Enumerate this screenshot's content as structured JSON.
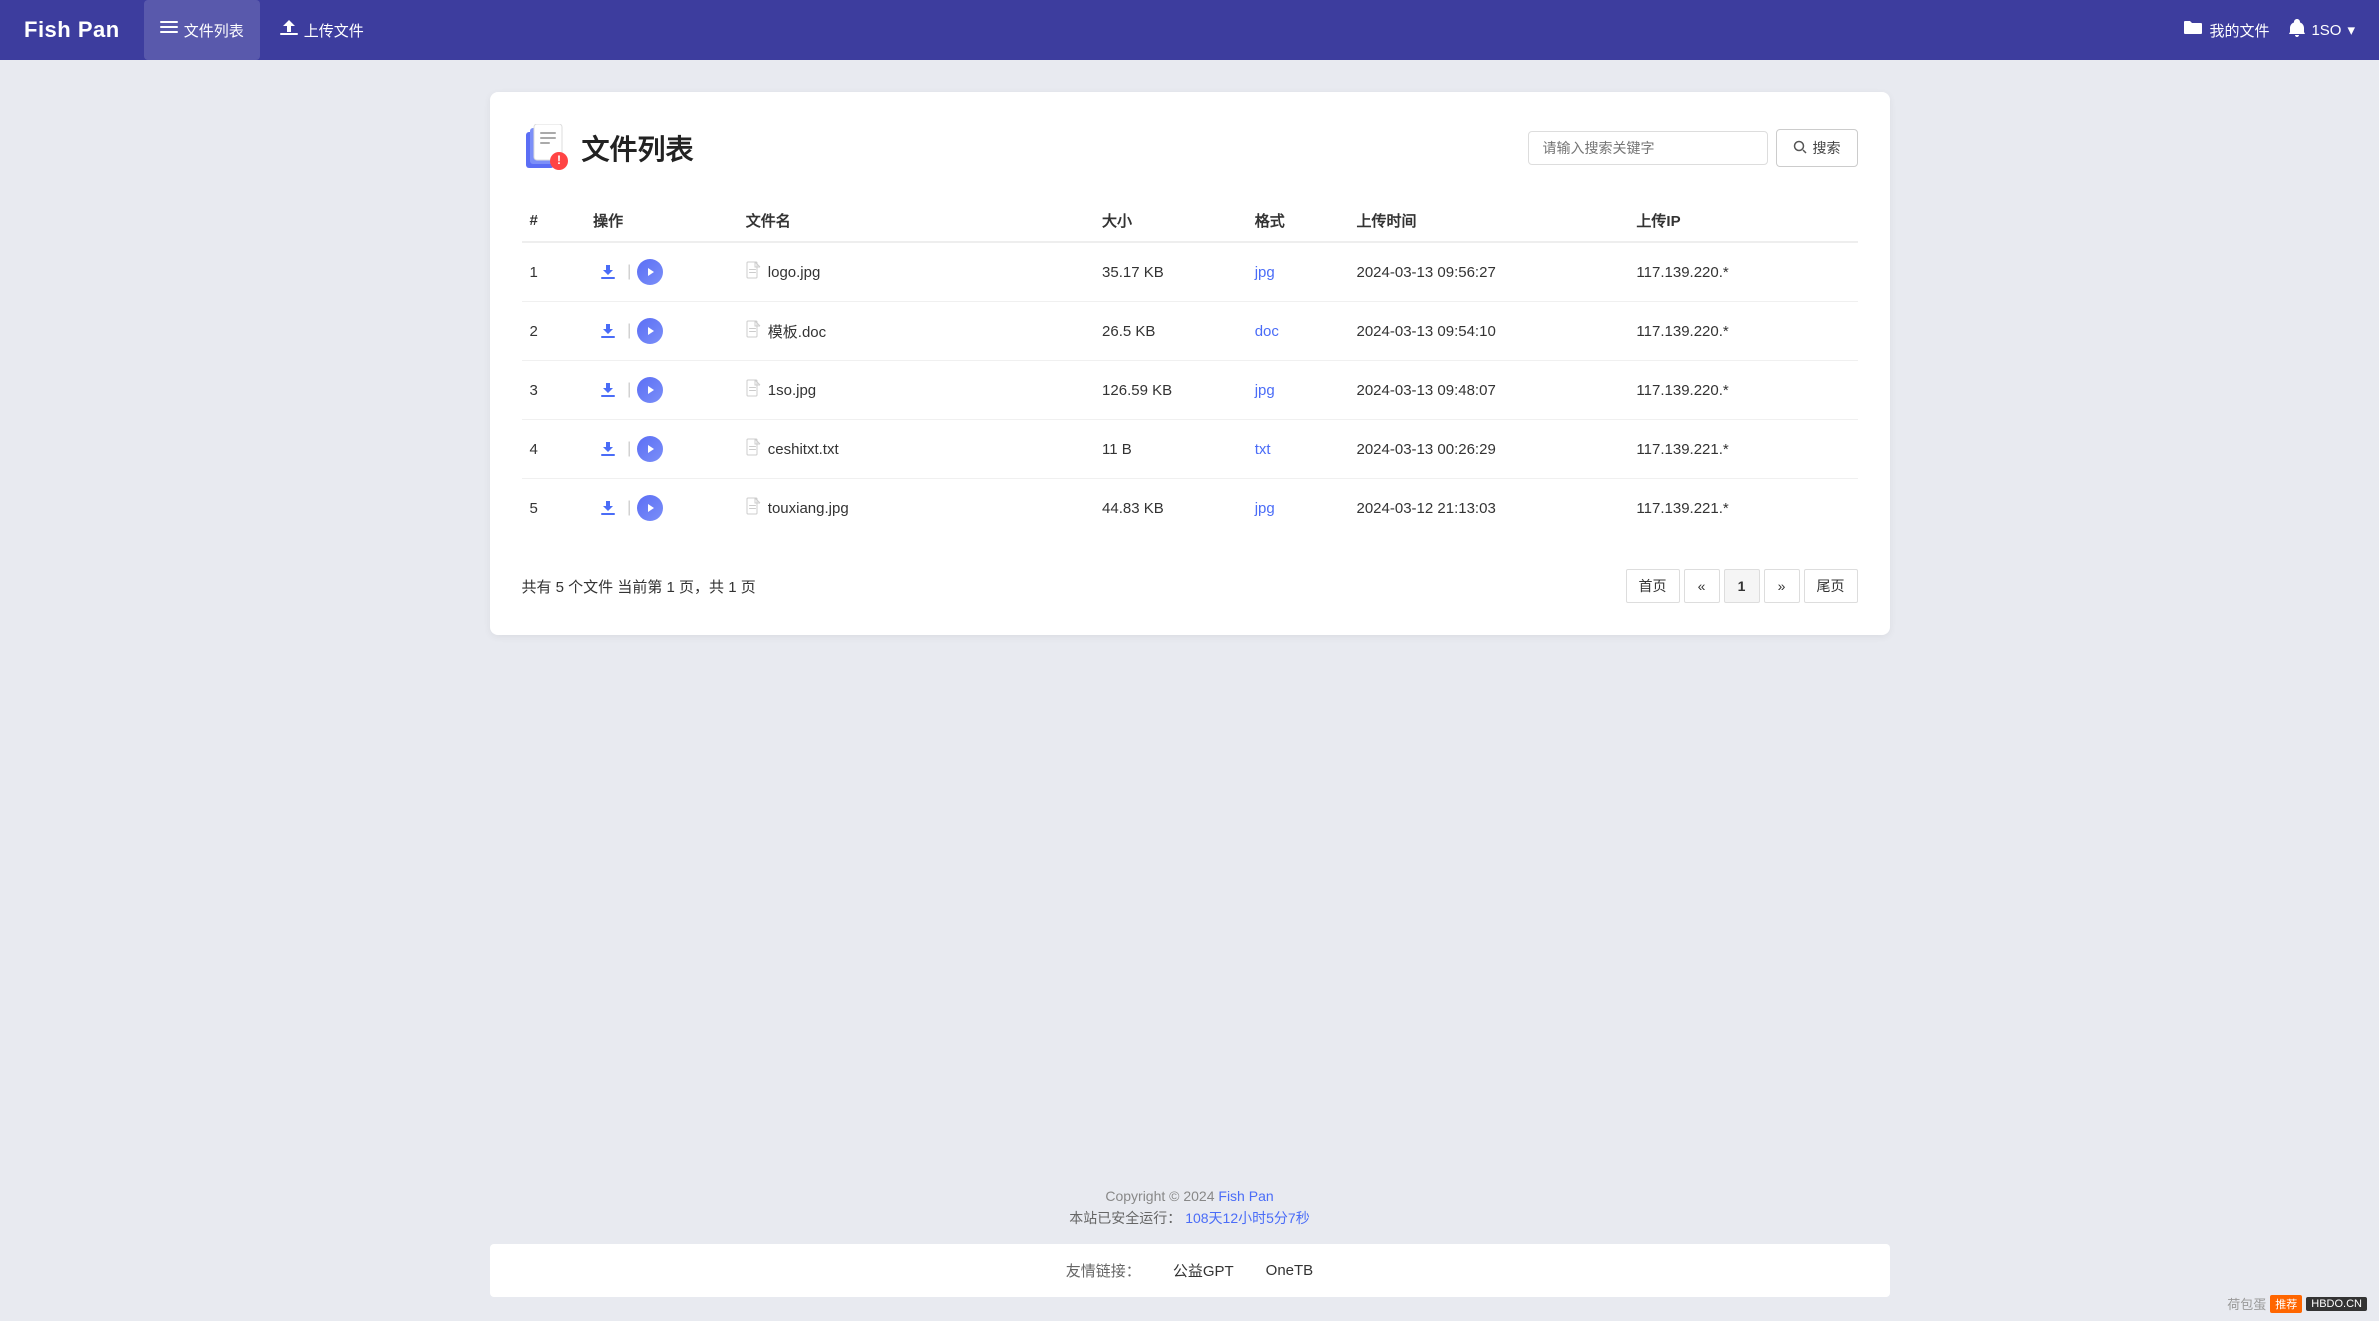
{
  "header": {
    "logo": "Fish Pan",
    "nav": [
      {
        "id": "file-list",
        "label": "文件列表",
        "active": true,
        "icon": "list-icon"
      },
      {
        "id": "upload",
        "label": "上传文件",
        "active": false,
        "icon": "upload-icon"
      }
    ],
    "right": [
      {
        "id": "my-files",
        "label": "我的文件",
        "icon": "folder-icon"
      },
      {
        "id": "user",
        "label": "1SO",
        "icon": "bell-icon",
        "hasDropdown": true
      }
    ]
  },
  "page": {
    "title": "文件列表",
    "search": {
      "placeholder": "请输入搜索关键字",
      "button_label": "搜索"
    },
    "table": {
      "columns": [
        "#",
        "操作",
        "文件名",
        "大小",
        "格式",
        "上传时间",
        "上传IP"
      ],
      "rows": [
        {
          "num": "1",
          "filename": "logo.jpg",
          "size": "35.17 KB",
          "format": "jpg",
          "time": "2024-03-13 09:56:27",
          "ip": "117.139.220.*",
          "file_icon": "📄"
        },
        {
          "num": "2",
          "filename": "模板.doc",
          "size": "26.5 KB",
          "format": "doc",
          "time": "2024-03-13 09:54:10",
          "ip": "117.139.220.*",
          "file_icon": "📄"
        },
        {
          "num": "3",
          "filename": "1so.jpg",
          "size": "126.59 KB",
          "format": "jpg",
          "time": "2024-03-13 09:48:07",
          "ip": "117.139.220.*",
          "file_icon": "📄"
        },
        {
          "num": "4",
          "filename": "ceshitxt.txt",
          "size": "11 B",
          "format": "txt",
          "time": "2024-03-13 00:26:29",
          "ip": "117.139.221.*",
          "file_icon": "📄"
        },
        {
          "num": "5",
          "filename": "touxiang.jpg",
          "size": "44.83 KB",
          "format": "jpg",
          "time": "2024-03-12 21:13:03",
          "ip": "117.139.221.*",
          "file_icon": "📄"
        }
      ]
    },
    "pagination": {
      "info": "共有 5 个文件 当前第 1 页，共 1 页",
      "first": "首页",
      "prev": "«",
      "current": "1",
      "next": "»",
      "last": "尾页"
    }
  },
  "footer": {
    "copyright": "Copyright © 2024",
    "brand": "Fish Pan",
    "runtime_label": "本站已安全运行：",
    "runtime_value": "108天12小时5分7秒",
    "links_label": "友情链接：",
    "links": [
      "公益GPT",
      "OneTB"
    ]
  },
  "watermark": {
    "text": "荷包蛋",
    "badge1": "推荐",
    "badge2": "HBDO.CN"
  }
}
